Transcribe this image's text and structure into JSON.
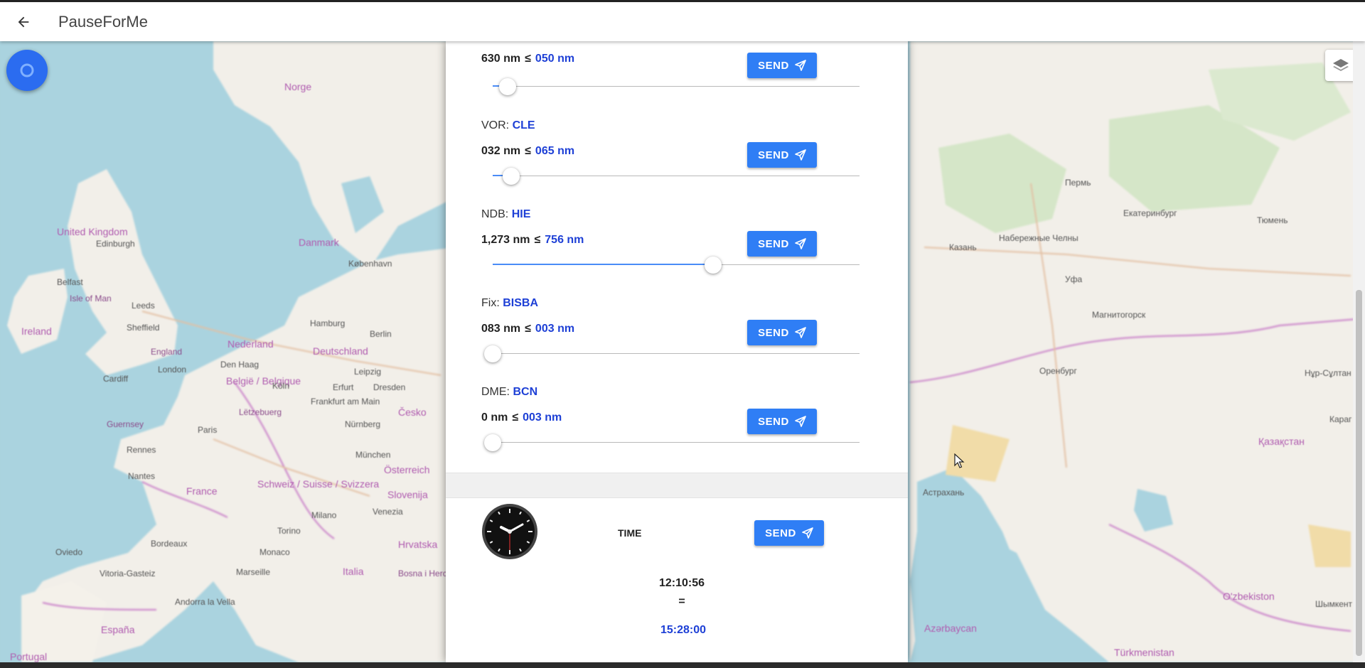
{
  "header": {
    "back_icon": "arrow-left-icon",
    "title": "PauseForMe"
  },
  "map": {
    "labels": {
      "norge": "Norge",
      "united_kingdom": "United Kingdom",
      "edinburgh": "Edinburgh",
      "isle_of_man": "Isle of Man",
      "ireland": "Ireland",
      "belfast": "Belfast",
      "leeds": "Leeds",
      "sheffield": "Sheffield",
      "england": "England",
      "london": "London",
      "cardiff": "Cardiff",
      "danmark": "Danmark",
      "kobenhavn": "København",
      "nederland": "Nederland",
      "den_haag": "Den Haag",
      "belgie": "België / Belgique",
      "luxembourg": "Lëtzebuerg",
      "deutschland": "Deutschland",
      "hamburg": "Hamburg",
      "berlin": "Berlin",
      "koln": "Köln",
      "frankfurt": "Frankfurt am Main",
      "erfurt": "Erfurt",
      "leipzig": "Leipzig",
      "dresden": "Dresden",
      "nurnberg": "Nürnberg",
      "munchen": "München",
      "osterreich": "Österreich",
      "cesko": "Česko",
      "paris": "Paris",
      "rennes": "Rennes",
      "nantes": "Nantes",
      "guernsey": "Guernsey",
      "france": "France",
      "bordeaux": "Bordeaux",
      "schweiz": "Schweiz / Suisse / Svizzera",
      "milano": "Milano",
      "venezia": "Venezia",
      "torino": "Torino",
      "italia": "Italia",
      "monaco": "Monaco",
      "marseille": "Marseille",
      "slovenija": "Slovenija",
      "hrvatska": "Hrvatska",
      "bosna": "Bosna i Hercegovina",
      "espana": "España",
      "portugal": "Portugal",
      "andorra": "Andorra la Vella",
      "oviedo": "Oviedo",
      "vitoria": "Vitoria-Gasteiz",
      "perm": "Пермь",
      "yekaterinburg": "Екатеринбург",
      "tyumen": "Тюмень",
      "kazan": "Казань",
      "naberezhnye": "Набережные Челны",
      "ufa": "Уфа",
      "magnitogorsk": "Магнитогорск",
      "orenburg": "Оренбург",
      "nur_sultan": "Нұр-Сұлтан",
      "karaganda": "Караг",
      "kazakhstan": "Қазақстан",
      "astrakhan": "Астрахань",
      "uzbekiston": "O'zbekiston",
      "turkmenistan": "Türkmenistan",
      "azerbaycan": "Azərbaycan",
      "shymkent": "Шымкент"
    },
    "locate_icon": "location-target-icon",
    "layers_icon": "layers-icon"
  },
  "panel": {
    "rows": [
      {
        "type": "",
        "ident": "",
        "current": "630 nm",
        "le": "≤",
        "target": "050 nm",
        "send_label": "SEND",
        "send_icon": "paper-plane-icon",
        "slider_fraction": 0.04
      },
      {
        "type": "VOR:",
        "ident": "CLE",
        "current": "032 nm",
        "le": "≤",
        "target": "065 nm",
        "send_label": "SEND",
        "send_icon": "paper-plane-icon",
        "slider_fraction": 0.05
      },
      {
        "type": "NDB:",
        "ident": "HIE",
        "current": "1,273 nm",
        "le": "≤",
        "target": "756 nm",
        "send_label": "SEND",
        "send_icon": "paper-plane-icon",
        "slider_fraction": 0.6
      },
      {
        "type": "Fix:",
        "ident": "BISBA",
        "current": "083 nm",
        "le": "≤",
        "target": "003 nm",
        "send_label": "SEND",
        "send_icon": "paper-plane-icon",
        "slider_fraction": 0.0
      },
      {
        "type": "DME:",
        "ident": "BCN",
        "current": "0 nm",
        "le": "≤",
        "target": "003 nm",
        "send_label": "SEND",
        "send_icon": "paper-plane-icon",
        "slider_fraction": 0.0
      }
    ],
    "time": {
      "clock_icon": "wall-clock-icon",
      "label": "TIME",
      "send_label": "SEND",
      "send_icon": "paper-plane-icon",
      "current": "12:10:56",
      "equals": "=",
      "target": "15:28:00"
    }
  },
  "colors": {
    "accent": "#2f7ef5",
    "value_blue": "#1e40d6",
    "water": "#aad3df",
    "land": "#f2efe9"
  }
}
